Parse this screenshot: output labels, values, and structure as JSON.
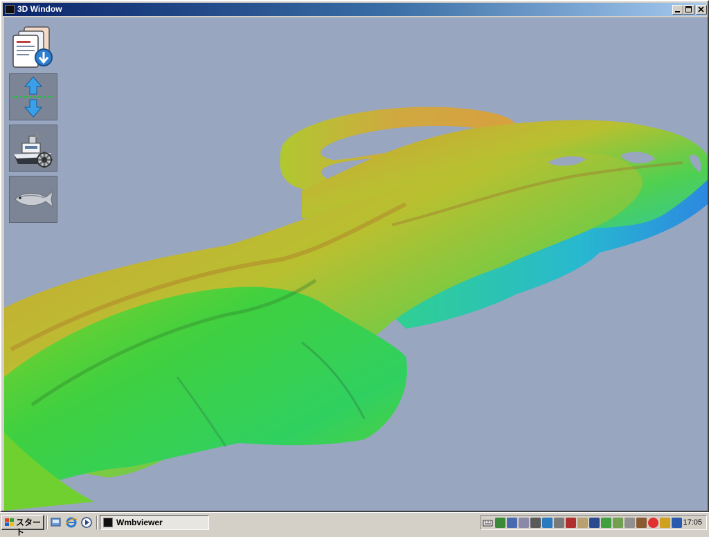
{
  "window": {
    "title": "3D Window",
    "icon": "app-icon",
    "controls": [
      "minimize-icon",
      "maximize-icon",
      "close-icon"
    ]
  },
  "viewport": {
    "background_color": "#98a6c0",
    "content": "3d-seafloor-bathymetry",
    "colormap": [
      "#d9a040",
      "#c8b030",
      "#90d020",
      "#40d040",
      "#20c8a0",
      "#3090e0"
    ]
  },
  "toolbar": {
    "tools": [
      {
        "icon": "documents-download-icon"
      },
      {
        "icon": "vertical-exaggeration-arrows-icon"
      },
      {
        "icon": "ship-settings-icon"
      },
      {
        "icon": "fish-icon"
      }
    ]
  },
  "taskbar": {
    "start_label": "スタート",
    "quick_launch": [
      "desktop-icon",
      "internet-explorer-icon",
      "media-player-icon"
    ],
    "tasks": [
      {
        "label": "Wmbviewer",
        "icon": "app-icon"
      }
    ],
    "tray_icons": [
      "keyboard-icon",
      "tray-icon-1",
      "tray-icon-2",
      "tray-icon-3",
      "tray-icon-4",
      "tray-icon-5",
      "tray-icon-6",
      "tray-icon-7",
      "tray-icon-8",
      "tray-icon-9",
      "tray-icon-10",
      "tray-icon-11",
      "tray-icon-12",
      "tray-icon-13",
      "tray-icon-14",
      "tray-icon-15",
      "tray-icon-16"
    ],
    "clock": "17:05"
  }
}
